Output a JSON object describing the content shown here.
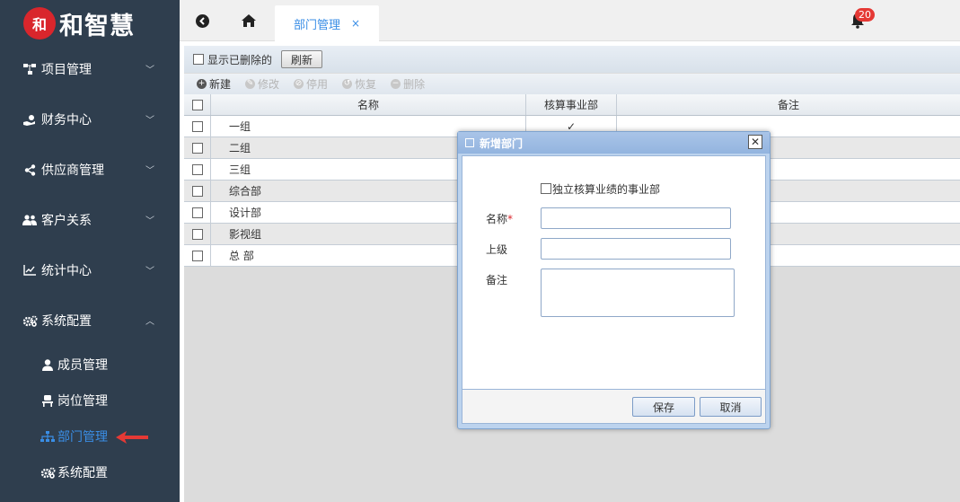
{
  "brand": {
    "logo_mark": "和",
    "logo_text": "和智慧",
    "logo_color": "#d9262c"
  },
  "sidebar": {
    "bg_color": "#2f3e4e",
    "active_color": "#3a8ee6",
    "items": [
      {
        "label": "项目管理",
        "icon": "project-icon"
      },
      {
        "label": "财务中心",
        "icon": "finance-icon"
      },
      {
        "label": "供应商管理",
        "icon": "share-icon"
      },
      {
        "label": "客户关系",
        "icon": "users-icon"
      },
      {
        "label": "统计中心",
        "icon": "chart-icon"
      },
      {
        "label": "系统配置",
        "icon": "gears-icon"
      }
    ],
    "sub_items": [
      {
        "label": "成员管理",
        "icon": "user-icon"
      },
      {
        "label": "岗位管理",
        "icon": "seat-icon"
      },
      {
        "label": "部门管理",
        "icon": "sitemap-icon"
      },
      {
        "label": "系统配置",
        "icon": "gears-icon"
      }
    ]
  },
  "topbar": {
    "tab_label": "部门管理",
    "tab_close": "×",
    "notification_count": "20"
  },
  "filter": {
    "show_deleted_label": "显示已删除的",
    "refresh_label": "刷新"
  },
  "toolbar": {
    "new_label": "新建",
    "edit_label": "修改",
    "disable_label": "停用",
    "restore_label": "恢复",
    "delete_label": "删除"
  },
  "grid": {
    "columns": [
      "名称",
      "核算事业部",
      "备注"
    ],
    "rows": [
      {
        "name": "一组",
        "accounting": "✓",
        "note": ""
      },
      {
        "name": "二组",
        "accounting": "",
        "note": ""
      },
      {
        "name": "三组",
        "accounting": "",
        "note": ""
      },
      {
        "name": "综合部",
        "accounting": "",
        "note": ""
      },
      {
        "name": "设计部",
        "accounting": "",
        "note": ""
      },
      {
        "name": "影视组",
        "accounting": "",
        "note": ""
      },
      {
        "name": "总 部",
        "accounting": "",
        "note": ""
      }
    ]
  },
  "dialog": {
    "title": "新增部门",
    "close": "✕",
    "independent_label": "独立核算业绩的事业部",
    "name_label": "名称",
    "required_mark": "*",
    "parent_label": "上级",
    "note_label": "备注",
    "name_value": "",
    "parent_value": "",
    "note_value": "",
    "save_label": "保存",
    "cancel_label": "取消"
  }
}
